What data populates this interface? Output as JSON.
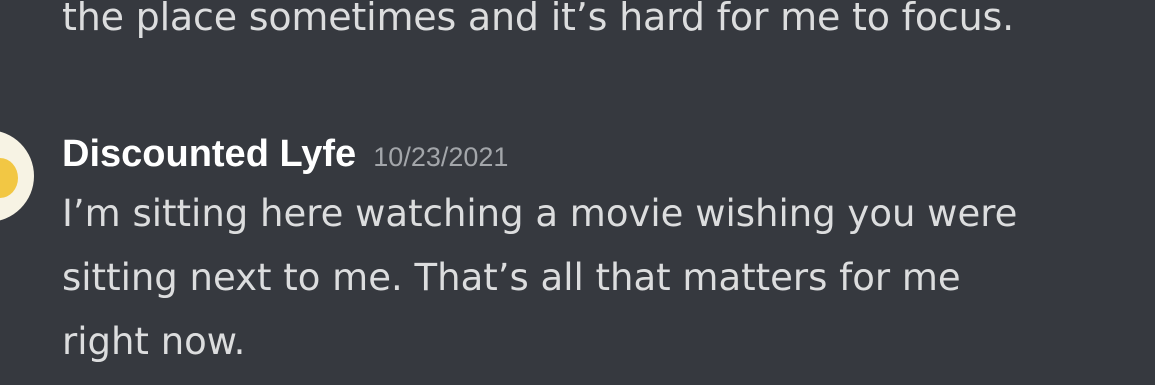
{
  "previous_message": {
    "text": "the place sometimes and it’s hard for me to focus."
  },
  "message": {
    "author": "Discounted Lyfe",
    "timestamp": "10/23/2021",
    "lines": [
      "I’m sitting here watching a movie wishing you were",
      "sitting next to me. That’s all that matters for me",
      "right now."
    ]
  },
  "colors": {
    "background": "#36393f",
    "author": "#ffffff",
    "text": "#dcddde",
    "timestamp": "#a3a6aa"
  }
}
